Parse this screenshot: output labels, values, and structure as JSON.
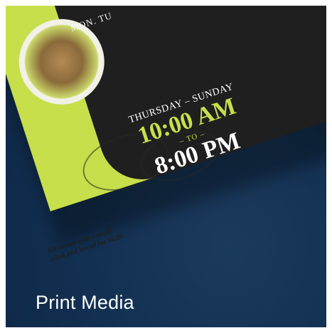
{
  "card": {
    "title": "Print Media"
  },
  "flyer": {
    "days_top": "MON. TU",
    "days_range": "THURSDAY – SUNDAY",
    "time_open": "10:00 AM",
    "separator": "– TO –",
    "time_close": "8:00 PM",
    "tagline": "All comes with a small salad and bread for $6.00",
    "colors": {
      "lime": "#c7df4a",
      "dark": "#1f1f1f",
      "background": "#123052"
    }
  }
}
